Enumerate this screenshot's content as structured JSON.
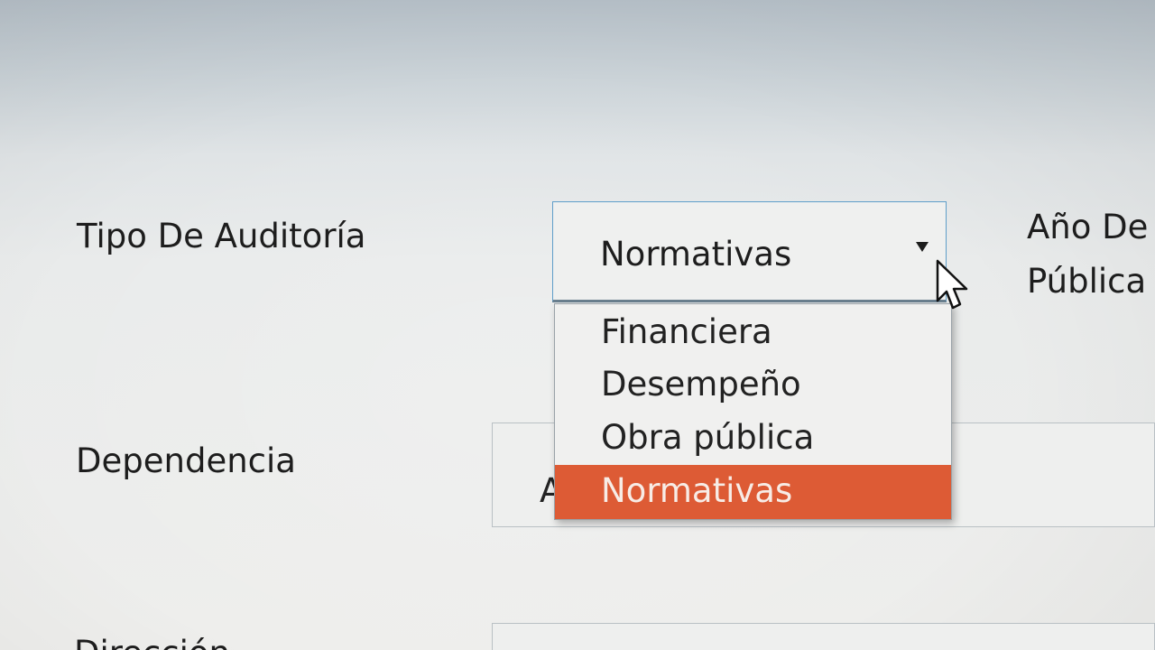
{
  "form": {
    "tipo_label": "Tipo De Auditoría",
    "tipo_selected": "Normativas",
    "ano_label_line1": "Año De",
    "ano_label_line2": "Pública",
    "dependencia_label": "Dependencia",
    "dependencia_value_partial": "A",
    "bottom_label_partial": "Dirección"
  },
  "dropdown": {
    "options": [
      "Financiera",
      "Desempeño",
      "Obra pública",
      "Normativas"
    ],
    "selected_index": 3,
    "highlight_color": "#dd5b35"
  },
  "colors": {
    "focus_border": "#5f9ec9",
    "field_border": "#b9c0c4",
    "background": "#eeeeec"
  },
  "icons": {
    "select_arrow": "triangle-down",
    "cursor": "mouse-pointer"
  }
}
